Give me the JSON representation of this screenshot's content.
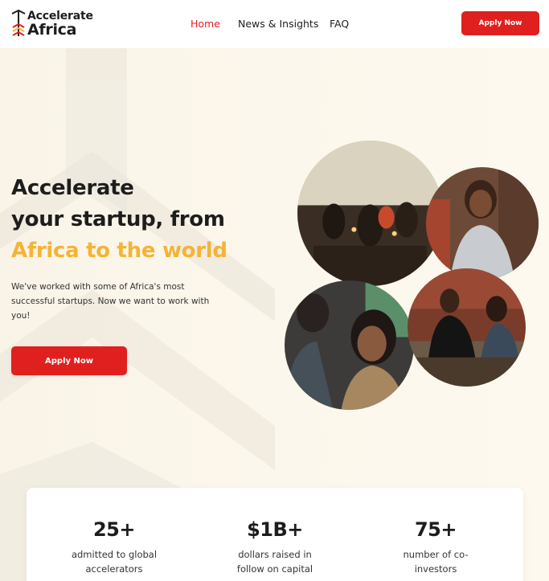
{
  "header": {
    "logo_line1": "Accelerate",
    "logo_line2": "Africa",
    "nav": [
      {
        "label": "Home",
        "active": true
      },
      {
        "label": "News & Insights",
        "active": false
      },
      {
        "label": "FAQ",
        "active": false
      }
    ],
    "apply_label": "Apply Now"
  },
  "hero": {
    "title_line1": "Accelerate",
    "title_line2": "your startup, from",
    "title_accent": "Africa to the world",
    "subtitle": "We've worked with some of Africa's most successful startups. Now we want to work with you!",
    "apply_label": "Apply Now"
  },
  "stats": [
    {
      "value": "25+",
      "label": "admitted to global accelerators"
    },
    {
      "value": "$1B+",
      "label": "dollars raised in follow on capital"
    },
    {
      "value": "75+",
      "label": "number of co-investors"
    }
  ],
  "colors": {
    "brand_red": "#e0201f",
    "accent_yellow": "#f5b335",
    "hero_bg": "#faf4e8",
    "text": "#1d1d1d"
  },
  "icons": {
    "logo": "accelerate-africa-arrow-icon"
  }
}
